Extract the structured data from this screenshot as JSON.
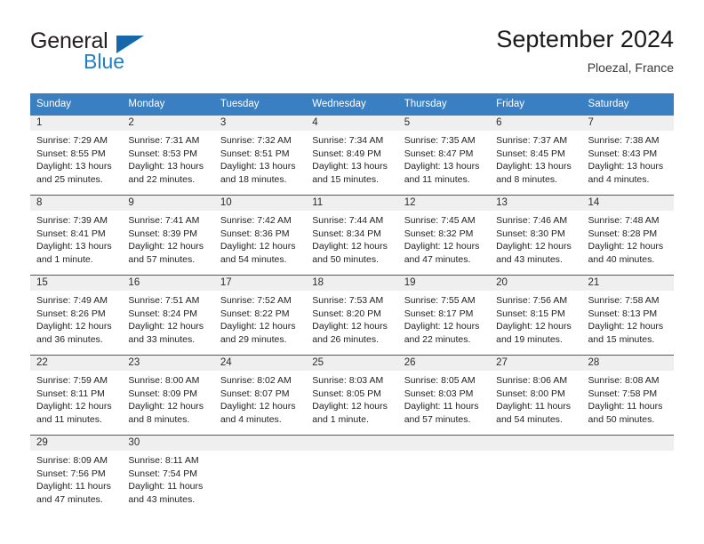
{
  "brand": {
    "name_part1": "General",
    "name_part2": "Blue"
  },
  "header": {
    "title": "September 2024",
    "location": "Ploezal, France"
  },
  "colors": {
    "header_blue": "#3a7fc1",
    "row_divider_blue": "#1668ad",
    "day_band_gray": "#efefef",
    "brand_blue": "#1f7ec4"
  },
  "weekdays": [
    "Sunday",
    "Monday",
    "Tuesday",
    "Wednesday",
    "Thursday",
    "Friday",
    "Saturday"
  ],
  "weeks": [
    [
      {
        "day": "1",
        "sunrise": "Sunrise: 7:29 AM",
        "sunset": "Sunset: 8:55 PM",
        "daylight1": "Daylight: 13 hours",
        "daylight2": "and 25 minutes."
      },
      {
        "day": "2",
        "sunrise": "Sunrise: 7:31 AM",
        "sunset": "Sunset: 8:53 PM",
        "daylight1": "Daylight: 13 hours",
        "daylight2": "and 22 minutes."
      },
      {
        "day": "3",
        "sunrise": "Sunrise: 7:32 AM",
        "sunset": "Sunset: 8:51 PM",
        "daylight1": "Daylight: 13 hours",
        "daylight2": "and 18 minutes."
      },
      {
        "day": "4",
        "sunrise": "Sunrise: 7:34 AM",
        "sunset": "Sunset: 8:49 PM",
        "daylight1": "Daylight: 13 hours",
        "daylight2": "and 15 minutes."
      },
      {
        "day": "5",
        "sunrise": "Sunrise: 7:35 AM",
        "sunset": "Sunset: 8:47 PM",
        "daylight1": "Daylight: 13 hours",
        "daylight2": "and 11 minutes."
      },
      {
        "day": "6",
        "sunrise": "Sunrise: 7:37 AM",
        "sunset": "Sunset: 8:45 PM",
        "daylight1": "Daylight: 13 hours",
        "daylight2": "and 8 minutes."
      },
      {
        "day": "7",
        "sunrise": "Sunrise: 7:38 AM",
        "sunset": "Sunset: 8:43 PM",
        "daylight1": "Daylight: 13 hours",
        "daylight2": "and 4 minutes."
      }
    ],
    [
      {
        "day": "8",
        "sunrise": "Sunrise: 7:39 AM",
        "sunset": "Sunset: 8:41 PM",
        "daylight1": "Daylight: 13 hours",
        "daylight2": "and 1 minute."
      },
      {
        "day": "9",
        "sunrise": "Sunrise: 7:41 AM",
        "sunset": "Sunset: 8:39 PM",
        "daylight1": "Daylight: 12 hours",
        "daylight2": "and 57 minutes."
      },
      {
        "day": "10",
        "sunrise": "Sunrise: 7:42 AM",
        "sunset": "Sunset: 8:36 PM",
        "daylight1": "Daylight: 12 hours",
        "daylight2": "and 54 minutes."
      },
      {
        "day": "11",
        "sunrise": "Sunrise: 7:44 AM",
        "sunset": "Sunset: 8:34 PM",
        "daylight1": "Daylight: 12 hours",
        "daylight2": "and 50 minutes."
      },
      {
        "day": "12",
        "sunrise": "Sunrise: 7:45 AM",
        "sunset": "Sunset: 8:32 PM",
        "daylight1": "Daylight: 12 hours",
        "daylight2": "and 47 minutes."
      },
      {
        "day": "13",
        "sunrise": "Sunrise: 7:46 AM",
        "sunset": "Sunset: 8:30 PM",
        "daylight1": "Daylight: 12 hours",
        "daylight2": "and 43 minutes."
      },
      {
        "day": "14",
        "sunrise": "Sunrise: 7:48 AM",
        "sunset": "Sunset: 8:28 PM",
        "daylight1": "Daylight: 12 hours",
        "daylight2": "and 40 minutes."
      }
    ],
    [
      {
        "day": "15",
        "sunrise": "Sunrise: 7:49 AM",
        "sunset": "Sunset: 8:26 PM",
        "daylight1": "Daylight: 12 hours",
        "daylight2": "and 36 minutes."
      },
      {
        "day": "16",
        "sunrise": "Sunrise: 7:51 AM",
        "sunset": "Sunset: 8:24 PM",
        "daylight1": "Daylight: 12 hours",
        "daylight2": "and 33 minutes."
      },
      {
        "day": "17",
        "sunrise": "Sunrise: 7:52 AM",
        "sunset": "Sunset: 8:22 PM",
        "daylight1": "Daylight: 12 hours",
        "daylight2": "and 29 minutes."
      },
      {
        "day": "18",
        "sunrise": "Sunrise: 7:53 AM",
        "sunset": "Sunset: 8:20 PM",
        "daylight1": "Daylight: 12 hours",
        "daylight2": "and 26 minutes."
      },
      {
        "day": "19",
        "sunrise": "Sunrise: 7:55 AM",
        "sunset": "Sunset: 8:17 PM",
        "daylight1": "Daylight: 12 hours",
        "daylight2": "and 22 minutes."
      },
      {
        "day": "20",
        "sunrise": "Sunrise: 7:56 AM",
        "sunset": "Sunset: 8:15 PM",
        "daylight1": "Daylight: 12 hours",
        "daylight2": "and 19 minutes."
      },
      {
        "day": "21",
        "sunrise": "Sunrise: 7:58 AM",
        "sunset": "Sunset: 8:13 PM",
        "daylight1": "Daylight: 12 hours",
        "daylight2": "and 15 minutes."
      }
    ],
    [
      {
        "day": "22",
        "sunrise": "Sunrise: 7:59 AM",
        "sunset": "Sunset: 8:11 PM",
        "daylight1": "Daylight: 12 hours",
        "daylight2": "and 11 minutes."
      },
      {
        "day": "23",
        "sunrise": "Sunrise: 8:00 AM",
        "sunset": "Sunset: 8:09 PM",
        "daylight1": "Daylight: 12 hours",
        "daylight2": "and 8 minutes."
      },
      {
        "day": "24",
        "sunrise": "Sunrise: 8:02 AM",
        "sunset": "Sunset: 8:07 PM",
        "daylight1": "Daylight: 12 hours",
        "daylight2": "and 4 minutes."
      },
      {
        "day": "25",
        "sunrise": "Sunrise: 8:03 AM",
        "sunset": "Sunset: 8:05 PM",
        "daylight1": "Daylight: 12 hours",
        "daylight2": "and 1 minute."
      },
      {
        "day": "26",
        "sunrise": "Sunrise: 8:05 AM",
        "sunset": "Sunset: 8:03 PM",
        "daylight1": "Daylight: 11 hours",
        "daylight2": "and 57 minutes."
      },
      {
        "day": "27",
        "sunrise": "Sunrise: 8:06 AM",
        "sunset": "Sunset: 8:00 PM",
        "daylight1": "Daylight: 11 hours",
        "daylight2": "and 54 minutes."
      },
      {
        "day": "28",
        "sunrise": "Sunrise: 8:08 AM",
        "sunset": "Sunset: 7:58 PM",
        "daylight1": "Daylight: 11 hours",
        "daylight2": "and 50 minutes."
      }
    ],
    [
      {
        "day": "29",
        "sunrise": "Sunrise: 8:09 AM",
        "sunset": "Sunset: 7:56 PM",
        "daylight1": "Daylight: 11 hours",
        "daylight2": "and 47 minutes."
      },
      {
        "day": "30",
        "sunrise": "Sunrise: 8:11 AM",
        "sunset": "Sunset: 7:54 PM",
        "daylight1": "Daylight: 11 hours",
        "daylight2": "and 43 minutes."
      },
      {
        "day": "",
        "sunrise": "",
        "sunset": "",
        "daylight1": "",
        "daylight2": ""
      },
      {
        "day": "",
        "sunrise": "",
        "sunset": "",
        "daylight1": "",
        "daylight2": ""
      },
      {
        "day": "",
        "sunrise": "",
        "sunset": "",
        "daylight1": "",
        "daylight2": ""
      },
      {
        "day": "",
        "sunrise": "",
        "sunset": "",
        "daylight1": "",
        "daylight2": ""
      },
      {
        "day": "",
        "sunrise": "",
        "sunset": "",
        "daylight1": "",
        "daylight2": ""
      }
    ]
  ]
}
